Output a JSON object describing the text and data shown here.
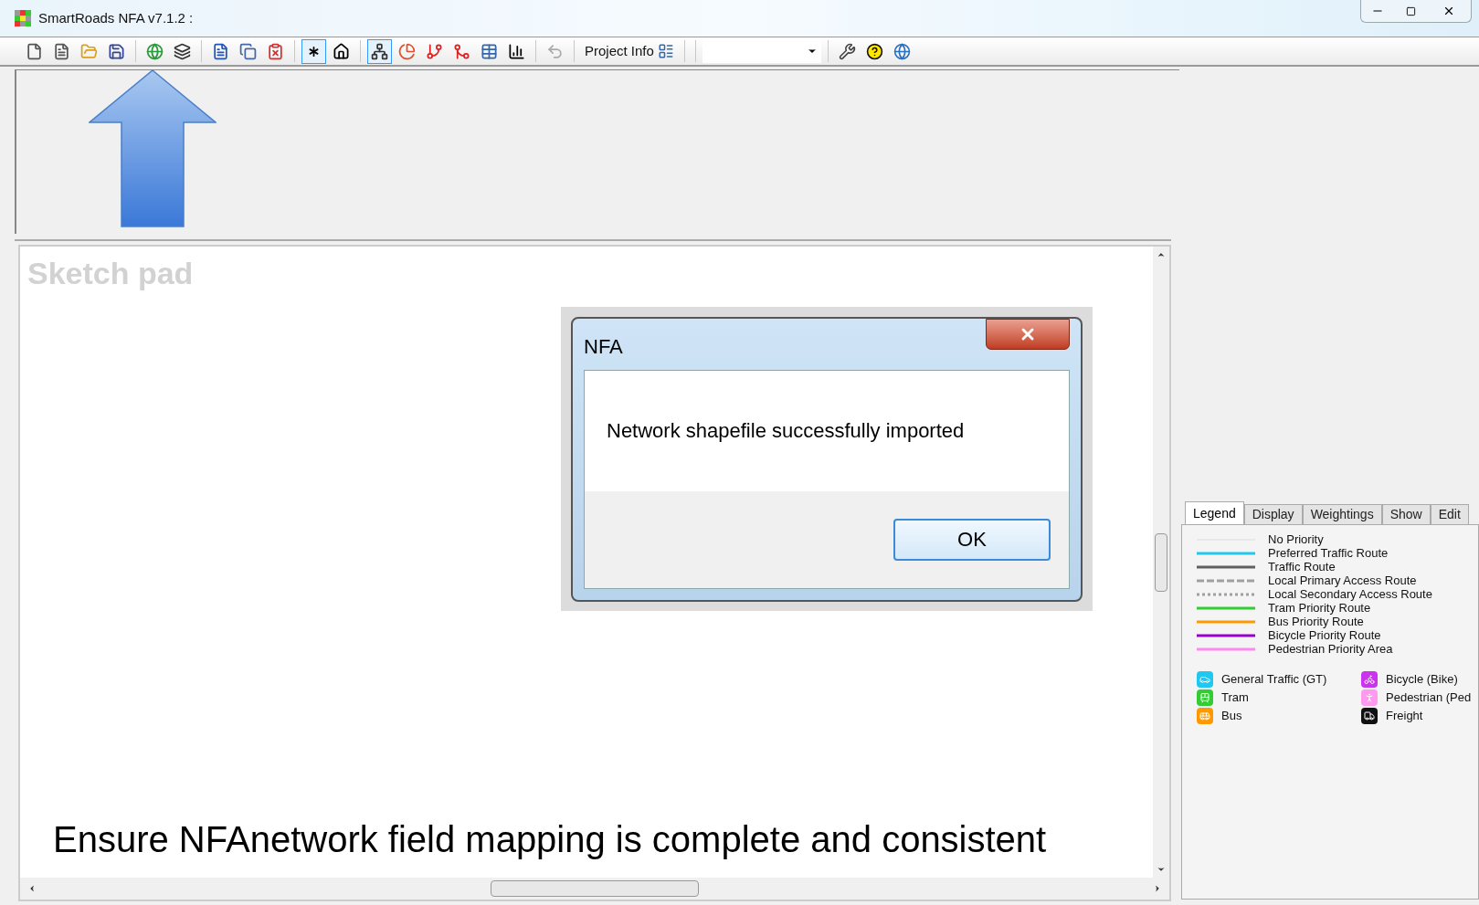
{
  "window": {
    "title": "SmartRoads NFA v7.1.2 :"
  },
  "toolbar": {
    "buttons": [
      {
        "pressed": false
      },
      {
        "pressed": false
      },
      {
        "pressed": false
      },
      {
        "pressed": false
      },
      {
        "pressed": false
      },
      {
        "pressed": false
      },
      {
        "pressed": false
      },
      {
        "pressed": false
      },
      {
        "pressed": false
      },
      {
        "pressed": true
      },
      {
        "pressed": false
      },
      {
        "pressed": true
      },
      {
        "pressed": false
      },
      {
        "pressed": false
      },
      {
        "pressed": false
      },
      {
        "pressed": false
      },
      {
        "pressed": false
      },
      {
        "pressed": false
      }
    ],
    "project_info": "Project Info"
  },
  "sketch_pad": {
    "title": "Sketch pad",
    "annotation": "Ensure NFAnetwork field mapping is complete and consistent"
  },
  "dialog": {
    "title": "NFA",
    "message": "Network shapefile successfully imported",
    "ok": "OK"
  },
  "tabs": [
    {
      "label": "Legend",
      "selected": true
    },
    {
      "label": "Display",
      "selected": false
    },
    {
      "label": "Weightings",
      "selected": false
    },
    {
      "label": "Show",
      "selected": false
    },
    {
      "label": "Edit",
      "selected": false
    }
  ],
  "legend": {
    "routes": [
      {
        "label": "No Priority",
        "color": "#dcdcdc",
        "kind": "thin"
      },
      {
        "label": "Preferred Traffic Route",
        "color": "#1ec8f0",
        "kind": "solid"
      },
      {
        "label": "Traffic Route",
        "color": "#606060",
        "kind": "solid"
      },
      {
        "label": "Local Primary Access Route",
        "color": "#a0a0a0",
        "kind": "dashed"
      },
      {
        "label": "Local Secondary Access Route",
        "color": "#a0a0a0",
        "kind": "dotted"
      },
      {
        "label": "Tram Priority Route",
        "color": "#33cc33",
        "kind": "solid"
      },
      {
        "label": "Bus Priority Route",
        "color": "#ff9900",
        "kind": "solid"
      },
      {
        "label": "Bicycle Priority Route",
        "color": "#9900cc",
        "kind": "solid"
      },
      {
        "label": "Pedestrian Priority Area",
        "color": "#ff88ee",
        "kind": "solid"
      }
    ],
    "modes": [
      {
        "label": "General Traffic (GT)",
        "color": "#1ec8f0"
      },
      {
        "label": "Bicycle (Bike)",
        "color": "#cc33ee"
      },
      {
        "label": "Tram",
        "color": "#33cc33"
      },
      {
        "label": "Pedestrian (Ped",
        "color": "#ff99ee"
      },
      {
        "label": "Bus",
        "color": "#ff9900"
      },
      {
        "label": "Freight",
        "color": "#111111"
      }
    ]
  }
}
